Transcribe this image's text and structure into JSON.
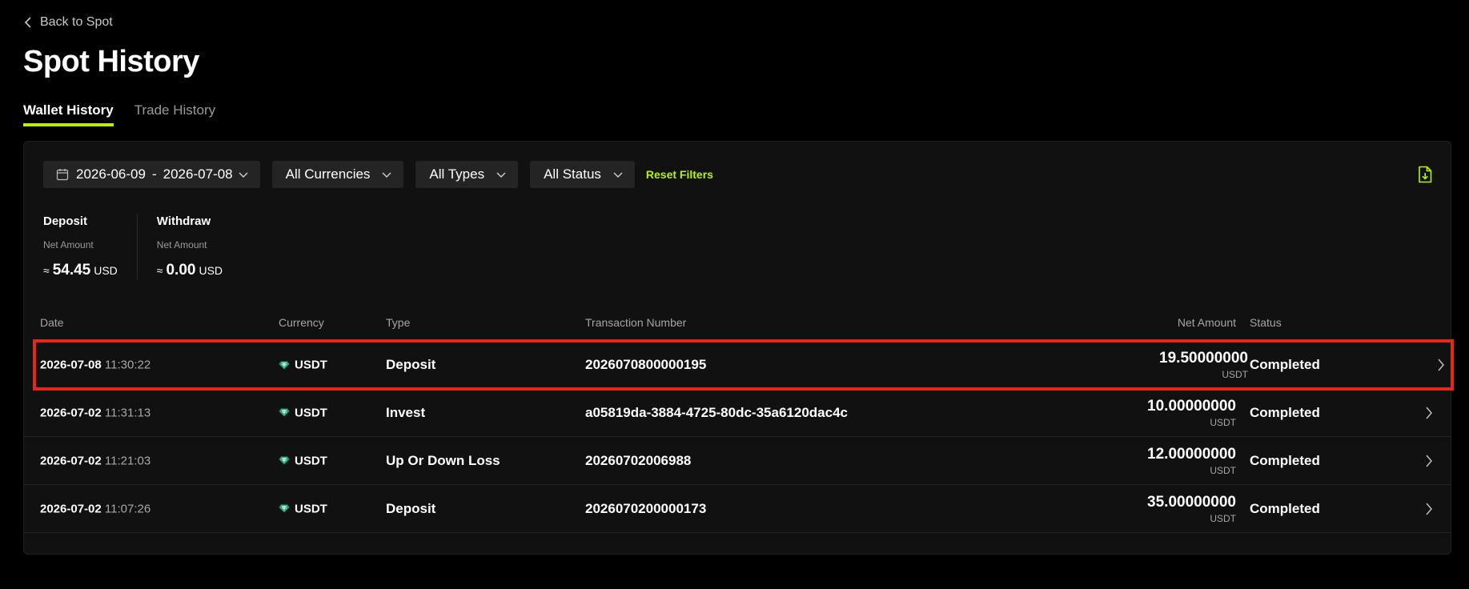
{
  "nav": {
    "back_label": "Back to Spot"
  },
  "page": {
    "title": "Spot History"
  },
  "tabs": [
    {
      "label": "Wallet History",
      "active": true
    },
    {
      "label": "Trade History",
      "active": false
    }
  ],
  "filters": {
    "date_start": "2026-06-09",
    "date_sep": "-",
    "date_end": "2026-07-08",
    "currency": "All Currencies",
    "type": "All Types",
    "status": "All Status",
    "reset_label": "Reset Filters"
  },
  "summary": {
    "deposit": {
      "title": "Deposit",
      "sub": "Net Amount",
      "approx": "≈",
      "value": "54.45",
      "unit": "USD"
    },
    "withdraw": {
      "title": "Withdraw",
      "sub": "Net Amount",
      "approx": "≈",
      "value": "0.00",
      "unit": "USD"
    }
  },
  "table": {
    "headers": {
      "date": "Date",
      "currency": "Currency",
      "type": "Type",
      "tx": "Transaction Number",
      "amount": "Net Amount",
      "status": "Status"
    },
    "rows": [
      {
        "date": "2026-07-08",
        "time": "11:30:22",
        "currency": "USDT",
        "type": "Deposit",
        "tx": "2026070800000195",
        "amount": "19.50000000",
        "unit": "USDT",
        "status": "Completed"
      },
      {
        "date": "2026-07-02",
        "time": "11:31:13",
        "currency": "USDT",
        "type": "Invest",
        "tx": "a05819da-3884-4725-80dc-35a6120dac4c",
        "amount": "10.00000000",
        "unit": "USDT",
        "status": "Completed"
      },
      {
        "date": "2026-07-02",
        "time": "11:21:03",
        "currency": "USDT",
        "type": "Up Or Down Loss",
        "tx": "20260702006988",
        "amount": "12.00000000",
        "unit": "USDT",
        "status": "Completed"
      },
      {
        "date": "2026-07-02",
        "time": "11:07:26",
        "currency": "USDT",
        "type": "Deposit",
        "tx": "2026070200000173",
        "amount": "35.00000000",
        "unit": "USDT",
        "status": "Completed"
      }
    ]
  },
  "colors": {
    "accent": "#b7f300",
    "highlight": "#e3281a",
    "tether": "#26a17b"
  },
  "icons": {
    "back": "chevron-left-icon",
    "calendar": "calendar-icon",
    "dropdown": "chevron-down-icon",
    "export": "download-file-icon",
    "currency": "tether-icon",
    "row_arrow": "chevron-right-icon"
  }
}
